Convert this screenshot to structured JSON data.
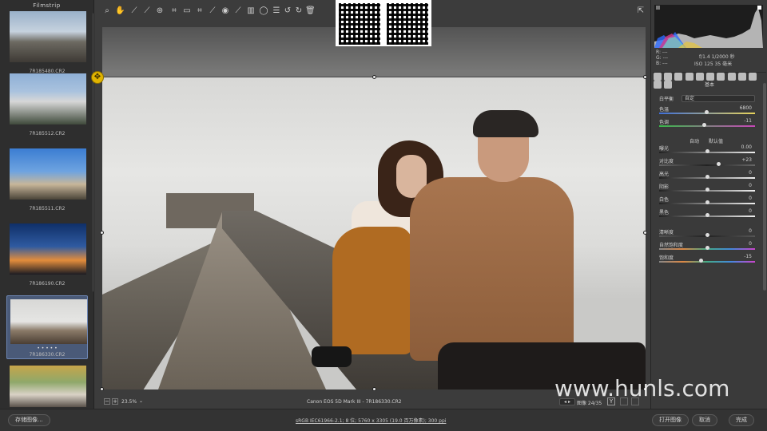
{
  "filmstrip": {
    "title": "Filmstrip",
    "items": [
      {
        "caption": "7R185480.CR2"
      },
      {
        "caption": "7R185512.CR2"
      },
      {
        "caption": "7R185511.CR2"
      },
      {
        "caption": "7R186190.CR2"
      },
      {
        "caption": "7R186330.CR2",
        "selected": true,
        "rating": "• • • • •"
      },
      {
        "caption": ""
      }
    ]
  },
  "toolbar": {
    "icons": [
      "zoom-icon",
      "hand-icon",
      "white-balance-icon",
      "color-sampler-icon",
      "target-adjust-icon",
      "crop-icon",
      "straighten-icon",
      "spot-removal-icon",
      "red-eye-icon",
      "adjustment-brush-icon",
      "graduated-filter-icon",
      "radial-filter-icon",
      "preferences-icon",
      "rotate-left-icon",
      "rotate-right-icon",
      "trash-icon"
    ],
    "fullscreen_icon": "fullscreen-icon"
  },
  "canvas": {
    "zoom_label": "23.5%",
    "camera_info": "Canon EOS 5D Mark III - 7R186330.CR2",
    "image_index": "图像 24/35",
    "compare_label": "Y"
  },
  "panel": {
    "exif": {
      "r": "R: ---",
      "g": "G: ---",
      "b": "B: ---",
      "aperture_shutter": "f/1.4  1/2000 秒",
      "iso_focal": "ISO 125  35 毫米"
    },
    "section_title": "基本",
    "white_balance": {
      "label": "白平衡",
      "value": "自定"
    },
    "temp": {
      "label": "色温",
      "value": "6800"
    },
    "tint": {
      "label": "色调",
      "value": "-11"
    },
    "auto_label": "自动",
    "default_label": "默认值",
    "exposure": {
      "label": "曝光",
      "value": "0.00"
    },
    "contrast": {
      "label": "对比度",
      "value": "+23"
    },
    "highlights": {
      "label": "高光",
      "value": "0"
    },
    "shadows": {
      "label": "阴影",
      "value": "0"
    },
    "whites": {
      "label": "白色",
      "value": "0"
    },
    "blacks": {
      "label": "黑色",
      "value": "0"
    },
    "clarity": {
      "label": "清晰度",
      "value": "0"
    },
    "vibrance": {
      "label": "自然饱和度",
      "value": "0"
    },
    "saturation": {
      "label": "饱和度",
      "value": "-15"
    }
  },
  "bottom": {
    "save_label": "存储图像...",
    "file_info": "sRGB IEC61966-2.1; 8 位; 5760 x 3305 (19.0 百万像素); 300 ppi",
    "open_label": "打开图像",
    "cancel_label": "取消",
    "done_label": "完成"
  },
  "watermark": "www.hunls.com",
  "colors": {
    "accent": "#e0b400",
    "selected": "#4a5a78"
  }
}
